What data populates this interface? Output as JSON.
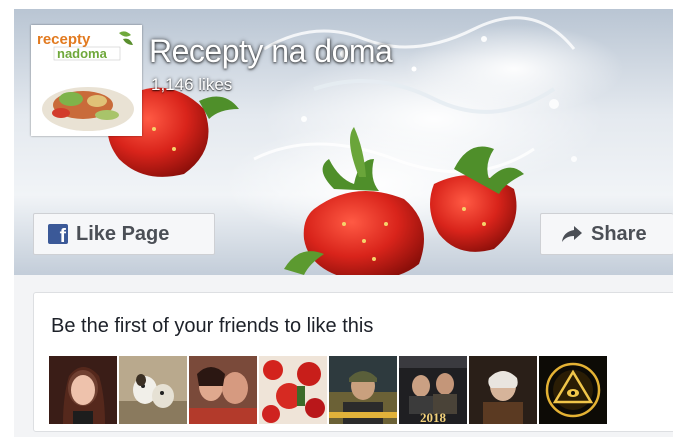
{
  "page": {
    "name": "Recepty na doma",
    "likes": "1,146 likes",
    "logo_text_line1": "recepty",
    "logo_text_line2": "nadoma"
  },
  "actions": {
    "like_label": "Like Page",
    "share_label": "Share"
  },
  "friends": {
    "prompt": "Be the first of your friends to like this",
    "faces": [
      {
        "name": "friend-face-1",
        "badge": ""
      },
      {
        "name": "friend-face-2",
        "badge": ""
      },
      {
        "name": "friend-face-3",
        "badge": ""
      },
      {
        "name": "friend-face-4",
        "badge": ""
      },
      {
        "name": "friend-face-5",
        "badge": ""
      },
      {
        "name": "friend-face-6",
        "badge": "2018"
      },
      {
        "name": "friend-face-7",
        "badge": ""
      },
      {
        "name": "friend-face-8",
        "badge": ""
      }
    ]
  },
  "colors": {
    "facebook_blue": "#3b5998",
    "button_bg": "#f6f7f9",
    "button_text": "#4b4f56",
    "plugin_bg": "#f3f4f6",
    "strawberry_red": "#d9241b",
    "logo_green": "#6fa83b",
    "logo_orange": "#e27a1f"
  },
  "icons": {
    "like": "facebook-f-icon",
    "share": "share-arrow-icon"
  }
}
